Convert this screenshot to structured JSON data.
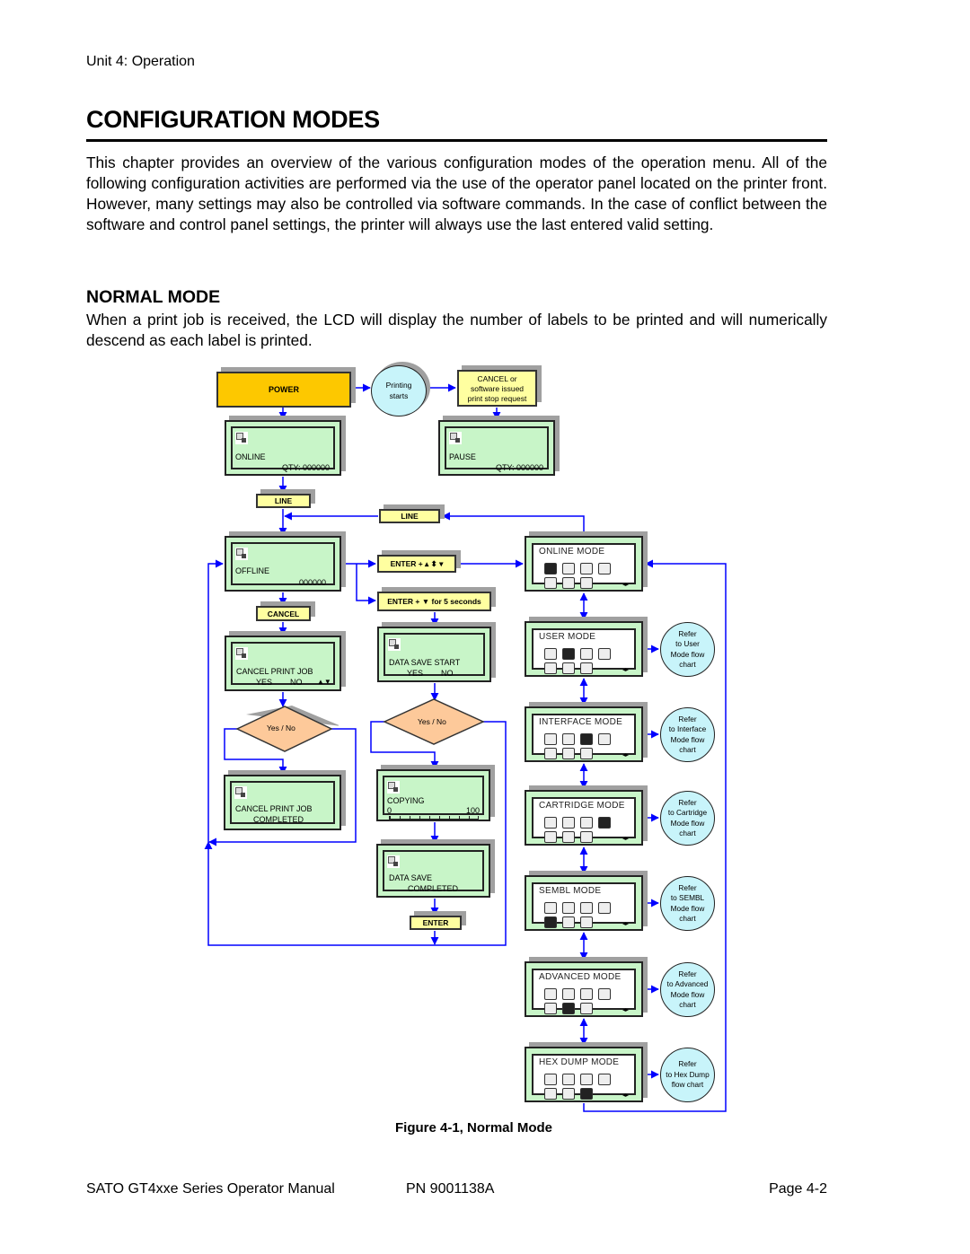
{
  "header": {
    "unit": "Unit 4:   Operation"
  },
  "title": "CONFIGURATION MODES",
  "intro": "This chapter provides an overview of the various configuration modes of the operation menu. All of the following configuration activities are performed via the use of the operator panel located on the printer front. However, many settings may also be controlled via software commands. In the case of conflict between the software and control panel settings, the printer will always use the last entered valid setting.",
  "section": {
    "heading": "NORMAL MODE",
    "text": "When a print job is received, the LCD will display the number of labels to be printed and will numerically descend as each label is printed."
  },
  "diagram": {
    "power": "POWER",
    "printing_starts": [
      "Printing",
      "starts"
    ],
    "cancel_note": [
      "CANCEL or",
      "software issued",
      "print stop request"
    ],
    "online_lcd": {
      "line1": "ONLINE",
      "line2": "QTY:  000000"
    },
    "pause_lcd": {
      "line1": "PAUSE",
      "line2": "QTY:  000000"
    },
    "line_key_1": "LINE",
    "line_key_2": "LINE",
    "offline_lcd": {
      "line1": "OFFLINE",
      "line2": "000000"
    },
    "enter_arrows": "ENTER +  ▴  ⬍  ▾",
    "enter_down_5s": "ENTER + ▼ for 5 seconds",
    "cancel_key": "CANCEL",
    "cancel_print_job_lcd": {
      "line1": "CANCEL PRINT JOB",
      "yes": "YES",
      "no": "NO",
      "arrows": "▲▼"
    },
    "data_save_start_lcd": {
      "line1": "DATA SAVE START",
      "yes": "YES",
      "no": "NO"
    },
    "decision_left": "Yes / No",
    "decision_right": "Yes / No",
    "cancel_completed_lcd": {
      "line1": "CANCEL PRINT JOB",
      "line2": "COMPLETED"
    },
    "copying_lcd": {
      "line1": "COPYING",
      "min": "0",
      "max": "100"
    },
    "data_save_completed_lcd": {
      "line1": "DATA SAVE",
      "line2": "COMPLETED"
    },
    "enter_key": "ENTER",
    "modes": [
      {
        "title": "ONLINE  MODE",
        "selected_icon": 0,
        "refer": null
      },
      {
        "title": "USER  MODE",
        "selected_icon": 1,
        "refer": [
          "Refer",
          "to User",
          "Mode flow",
          "chart"
        ]
      },
      {
        "title": "INTERFACE  MODE",
        "selected_icon": 2,
        "refer": [
          "Refer",
          "to Interface",
          "Mode flow",
          "chart"
        ]
      },
      {
        "title": "CARTRIDGE  MODE",
        "selected_icon": 3,
        "refer": [
          "Refer",
          "to Cartridge",
          "Mode flow",
          "chart"
        ]
      },
      {
        "title": "SEMBL  MODE",
        "selected_icon": 4,
        "refer": [
          "Refer",
          "to SEMBL",
          "Mode flow",
          "chart"
        ]
      },
      {
        "title": "ADVANCED  MODE",
        "selected_icon": 5,
        "refer": [
          "Refer",
          "to Advanced",
          "Mode flow",
          "chart"
        ]
      },
      {
        "title": "HEX  DUMP  MODE",
        "selected_icon": 6,
        "refer": [
          "Refer",
          "to Hex Dump",
          "flow chart"
        ]
      }
    ],
    "colors": {
      "connector": "#0000ff",
      "power": "#fdc800",
      "key": "#ffffa0",
      "lcd": "#c8f5c8",
      "circle": "#c8f4fa",
      "decision": "#fdc99a"
    }
  },
  "caption": "Figure 4-1, Normal Mode",
  "footer": {
    "left": "SATO GT4xxe Series Operator Manual",
    "middle": "PN  9001138A",
    "right": "Page 4-2"
  }
}
